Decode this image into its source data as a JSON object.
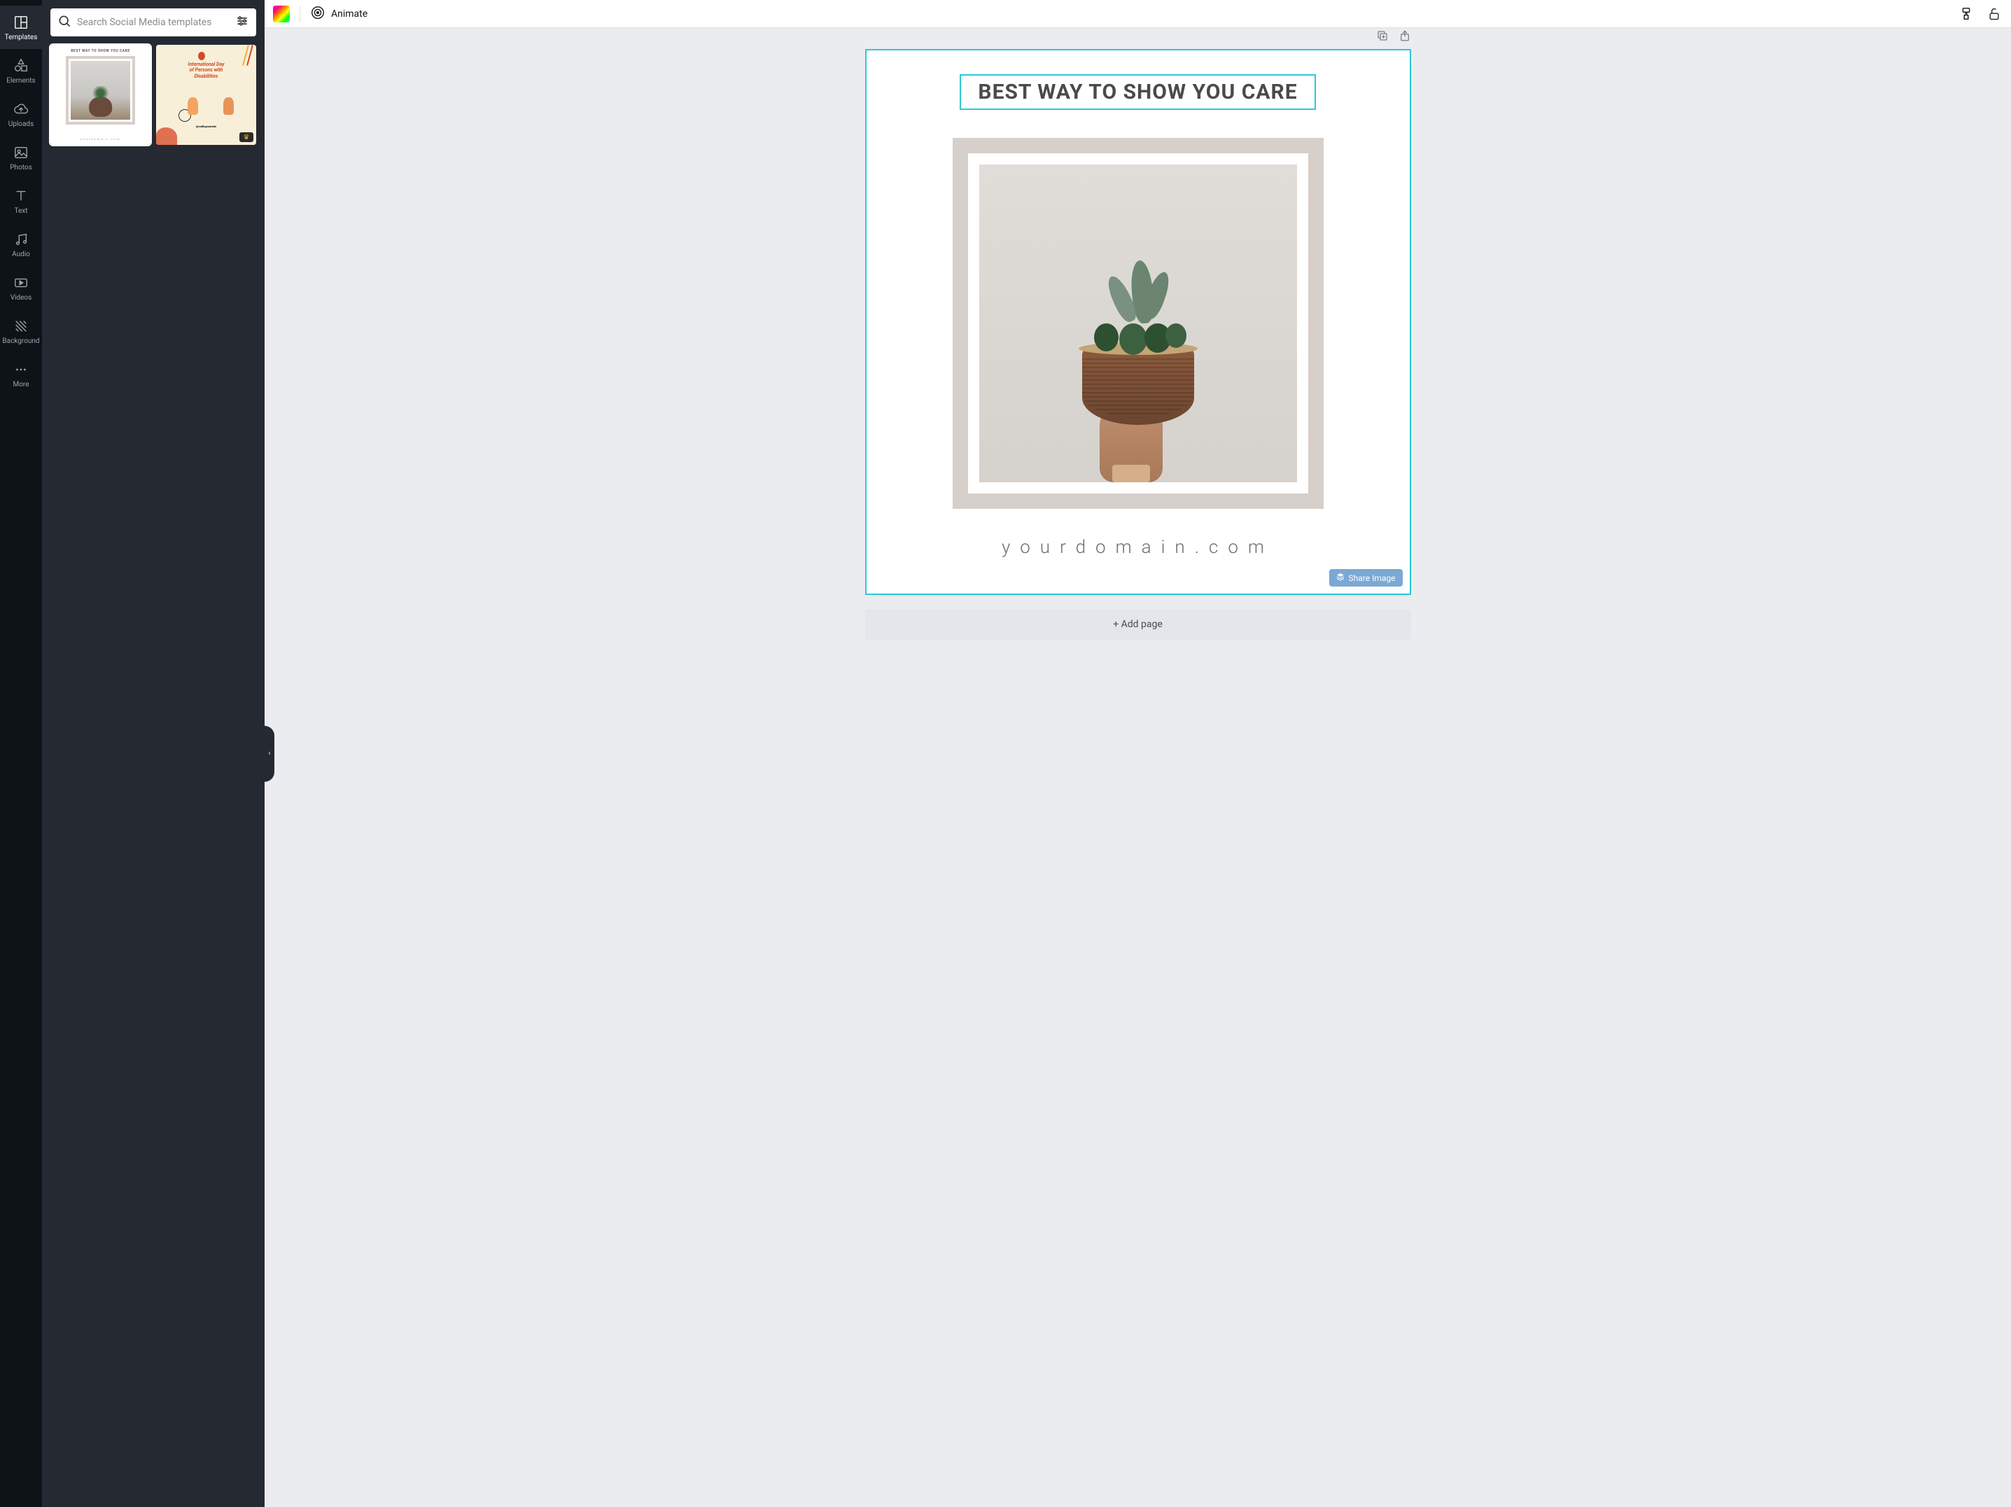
{
  "sidebar": {
    "items": [
      {
        "label": "Templates",
        "icon": "templates"
      },
      {
        "label": "Elements",
        "icon": "elements"
      },
      {
        "label": "Uploads",
        "icon": "uploads"
      },
      {
        "label": "Photos",
        "icon": "photos"
      },
      {
        "label": "Text",
        "icon": "text"
      },
      {
        "label": "Audio",
        "icon": "audio"
      },
      {
        "label": "Videos",
        "icon": "videos"
      },
      {
        "label": "Background",
        "icon": "background"
      },
      {
        "label": "More",
        "icon": "more"
      }
    ],
    "activeIndex": 0
  },
  "search": {
    "placeholder": "Search Social Media templates"
  },
  "templates": {
    "thumb1": {
      "title": "BEST WAY TO SHOW YOU CARE",
      "footer": "yourdomain.com"
    },
    "thumb2": {
      "title_line1": "International Day",
      "title_line2": "of Persons with",
      "title_line3": "Disabilities",
      "footer": "@reallygreatsite"
    }
  },
  "toolbar": {
    "animate_label": "Animate"
  },
  "canvas": {
    "headline": "BEST WAY TO SHOW YOU CARE",
    "domain": "yourdomain.com",
    "share_label": "Share Image"
  },
  "actions": {
    "add_page": "+ Add page"
  },
  "colors": {
    "selection": "#2cc8d6",
    "share_btn": "#7ba8d4",
    "frame": "#d7cfc9"
  }
}
